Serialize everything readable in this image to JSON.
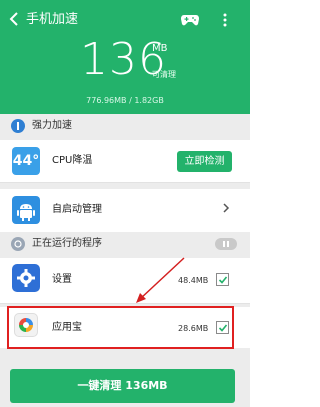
{
  "header": {
    "back_icon": "back-arrow-icon",
    "title": "手机加速",
    "game_icon": "gamepad-icon",
    "more_icon": "more-vert-icon",
    "memory_amount": "136",
    "memory_unit": "MB",
    "memory_caption": "可清理",
    "memory_usage": "776.96MB / 1.82GB",
    "bg_color": "#23b26b"
  },
  "boost_section": {
    "label": "强力加速"
  },
  "cpu_row": {
    "tile_text": "44°",
    "label": "CPU降温",
    "button_label": "立即检测"
  },
  "autostart_row": {
    "label": "自启动管理"
  },
  "running_section": {
    "label": "正在运行的程序"
  },
  "apps": [
    {
      "name": "设置",
      "size": "48.4MB",
      "checked": true,
      "icon": "settings-gear-icon"
    },
    {
      "name": "应用宝",
      "size": "28.6MB",
      "checked": true,
      "icon": "app-store-icon"
    }
  ],
  "clean_button": {
    "label": "一键清理 136MB"
  }
}
